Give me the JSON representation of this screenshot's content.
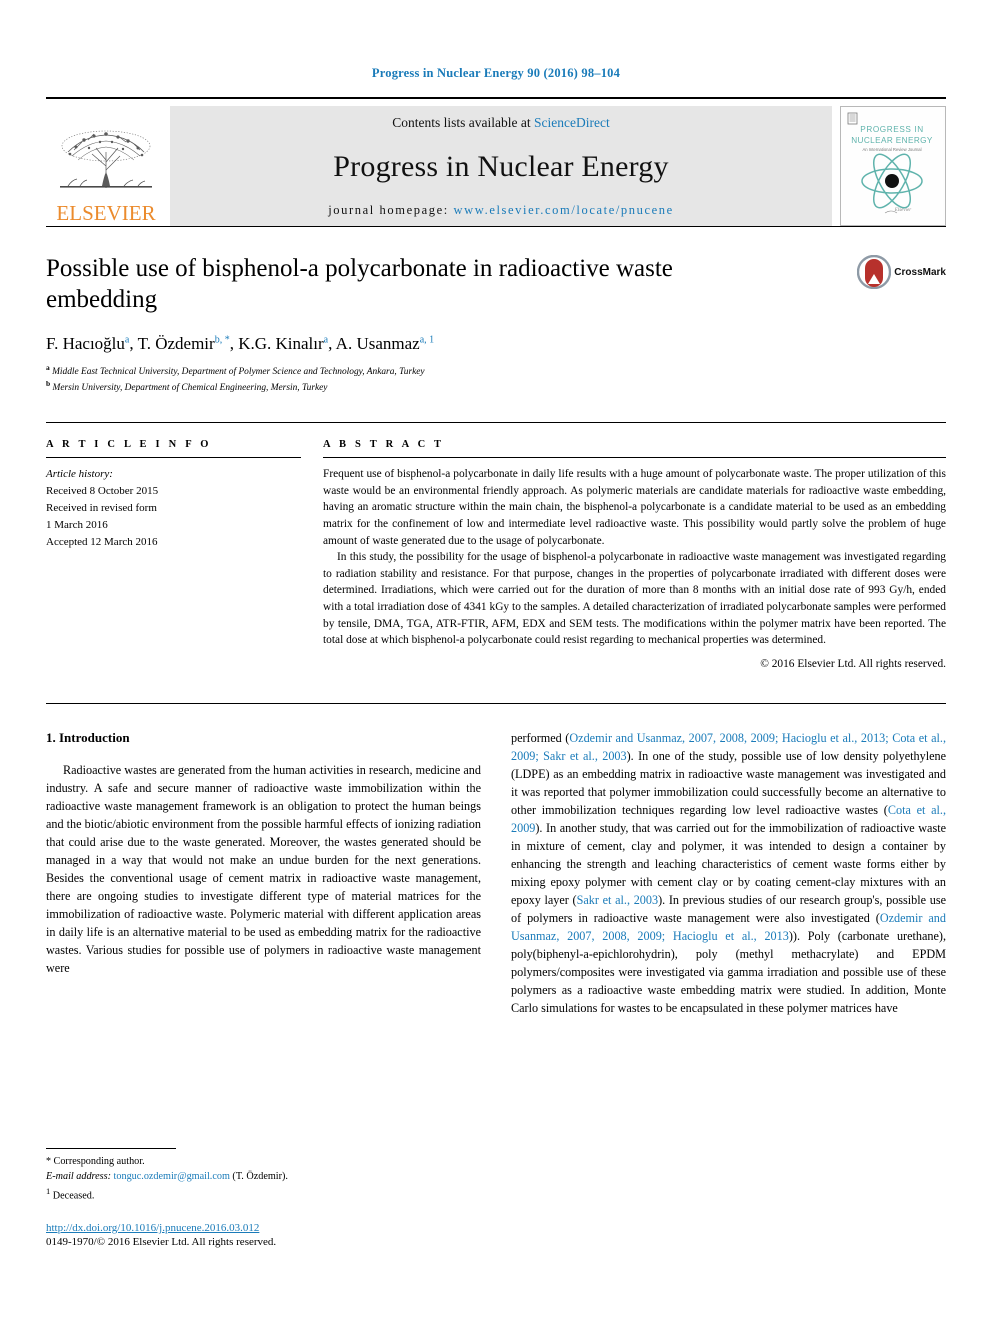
{
  "running_head": "Progress in Nuclear Energy 90 (2016) 98–104",
  "banner": {
    "publisher_name": "ELSEVIER",
    "contents_prefix": "Contents lists available at",
    "contents_link": "ScienceDirect",
    "journal_name": "Progress in Nuclear Energy",
    "homepage_prefix": "journal homepage:",
    "homepage_url": "www.elsevier.com/locate/pnucene",
    "cover": {
      "line1": "PROGRESS IN",
      "line2": "NUCLEAR ENERGY",
      "tagline": "An International Review Journal",
      "footer": "Elsevier"
    }
  },
  "article": {
    "title": "Possible use of bisphenol-a polycarbonate in radioactive waste embedding",
    "crossmark_label": "CrossMark",
    "authors": [
      {
        "name": "F. Hacıoğlu",
        "marks": "a"
      },
      {
        "name": "T. Özdemir",
        "marks": "b, *"
      },
      {
        "name": "K.G. Kinalır",
        "marks": "a"
      },
      {
        "name": "A. Usanmaz",
        "marks": "a, 1"
      }
    ],
    "affiliations": [
      {
        "mark": "a",
        "text": "Middle East Technical University, Department of Polymer Science and Technology, Ankara, Turkey"
      },
      {
        "mark": "b",
        "text": "Mersin University, Department of Chemical Engineering, Mersin, Turkey"
      }
    ]
  },
  "article_info": {
    "heading": "A R T I C L E  I N F O",
    "history_label": "Article history:",
    "history": [
      "Received 8 October 2015",
      "Received in revised form",
      "1 March 2016",
      "Accepted 12 March 2016"
    ]
  },
  "abstract": {
    "heading": "A B S T R A C T",
    "paragraphs": [
      "Frequent use of bisphenol-a polycarbonate in daily life results with a huge amount of polycarbonate waste. The proper utilization of this waste would be an environmental friendly approach. As polymeric materials are candidate materials for radioactive waste embedding, having an aromatic structure within the main chain, the bisphenol-a polycarbonate is a candidate material to be used as an embedding matrix for the confinement of low and intermediate level radioactive waste. This possibility would partly solve the problem of huge amount of waste generated due to the usage of polycarbonate.",
      "In this study, the possibility for the usage of bisphenol-a polycarbonate in radioactive waste management was investigated regarding to radiation stability and resistance. For that purpose, changes in the properties of polycarbonate irradiated with different doses were determined. Irradiations, which were carried out for the duration of more than 8 months with an initial dose rate of 993 Gy/h, ended with a total irradiation dose of 4341 kGy to the samples. A detailed characterization of irradiated polycarbonate samples were performed by tensile, DMA, TGA, ATR-FTIR, AFM, EDX and SEM tests. The modifications within the polymer matrix have been reported. The total dose at which bisphenol-a polycarbonate could resist regarding to mechanical properties was determined."
    ],
    "copyright": "© 2016 Elsevier Ltd. All rights reserved."
  },
  "body": {
    "section_title": "1. Introduction",
    "left_paragraph": "Radioactive wastes are generated from the human activities in research, medicine and industry. A safe and secure manner of radioactive waste immobilization within the radioactive waste management framework is an obligation to protect the human beings and the biotic/abiotic environment from the possible harmful effects of ionizing radiation that could arise due to the waste generated. Moreover, the wastes generated should be managed in a way that would not make an undue burden for the next generations. Besides the conventional usage of cement matrix in radioactive waste management, there are ongoing studies to investigate different type of material matrices for the immobilization of radioactive waste. Polymeric material with different application areas in daily life is an alternative material to be used as embedding matrix for the radioactive wastes. Various studies for possible use of polymers in radioactive waste management were",
    "right_segments": [
      {
        "text": "performed (",
        "link": false
      },
      {
        "text": "Ozdemir and Usanmaz, 2007, 2008, 2009; Hacioglu et al., 2013; Cota et al., 2009; Sakr et al., 2003",
        "link": true
      },
      {
        "text": "). In one of the study, possible use of low density polyethylene (LDPE) as an embedding matrix in radioactive waste management was investigated and it was reported that polymer immobilization could successfully become an alternative to other immobilization techniques regarding low level radioactive wastes (",
        "link": false
      },
      {
        "text": "Cota et al., 2009",
        "link": true
      },
      {
        "text": "). In another study, that was carried out for the immobilization of radioactive waste in mixture of cement, clay and polymer, it was intended to design a container by enhancing the strength and leaching characteristics of cement waste forms either by mixing epoxy polymer with cement clay or by coating cement-clay mixtures with an epoxy layer (",
        "link": false
      },
      {
        "text": "Sakr et al., 2003",
        "link": true
      },
      {
        "text": "). In previous studies of our research group's, possible use of polymers in radioactive waste management were also investigated (",
        "link": false
      },
      {
        "text": "Ozdemir and Usanmaz, 2007, 2008, 2009; Hacioglu et al., 2013",
        "link": true
      },
      {
        "text": ")). Poly (carbonate urethane), poly(biphenyl-a-epichlorohydrin), poly (methyl methacrylate) and EPDM polymers/composites were investigated via gamma irradiation and possible use of these polymers as a radioactive waste embedding matrix were studied. In addition, Monte Carlo simulations for wastes to be encapsulated in these polymer matrices have",
        "link": false
      }
    ]
  },
  "footnotes": {
    "corresponding": "Corresponding author.",
    "email_label": "E-mail address:",
    "email": "tonguc.ozdemir@gmail.com",
    "email_suffix": "(T. Özdemir).",
    "deceased_mark": "1",
    "deceased": "Deceased."
  },
  "footer": {
    "doi": "http://dx.doi.org/10.1016/j.pnucene.2016.03.012",
    "issn_line": "0149-1970/© 2016 Elsevier Ltd. All rights reserved."
  },
  "colors": {
    "link_blue": "#1a7bb9",
    "elsevier_orange": "#eb8b2d",
    "cover_teal": "#5fb3ac",
    "crossmark_red": "#b7312c"
  }
}
